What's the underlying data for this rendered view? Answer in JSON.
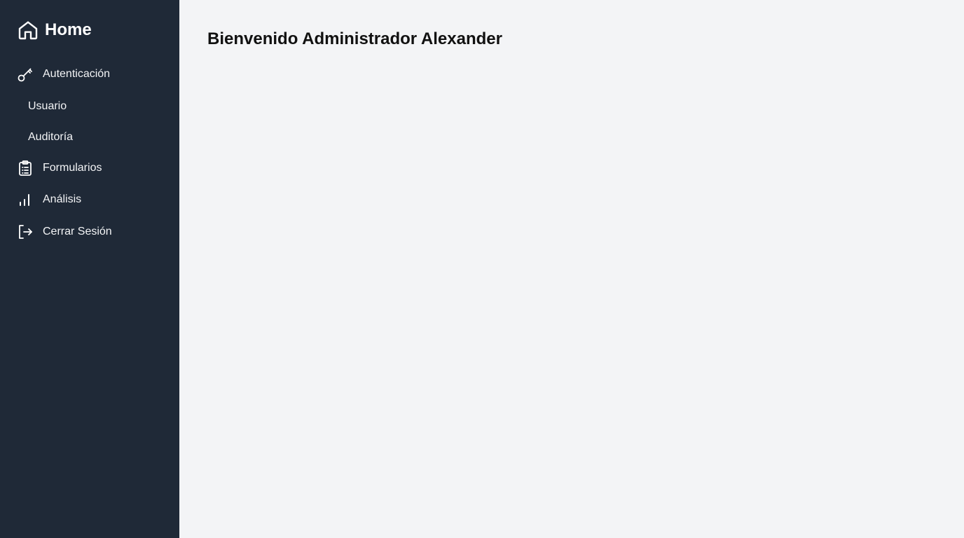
{
  "sidebar": {
    "brand": {
      "label": "Home",
      "icon": "home-icon"
    },
    "items": [
      {
        "label": "Autenticación",
        "icon": "key-icon"
      },
      {
        "label": "Usuario"
      },
      {
        "label": "Auditoría"
      },
      {
        "label": "Formularios",
        "icon": "clipboard-list-icon"
      },
      {
        "label": "Análisis",
        "icon": "bar-chart-icon"
      },
      {
        "label": "Cerrar Sesión",
        "icon": "logout-icon"
      }
    ]
  },
  "main": {
    "title": "Bienvenido Administrador Alexander"
  },
  "colors": {
    "sidebar_bg": "#1f2937",
    "main_bg": "#f3f4f6",
    "sidebar_text": "#ffffff"
  }
}
